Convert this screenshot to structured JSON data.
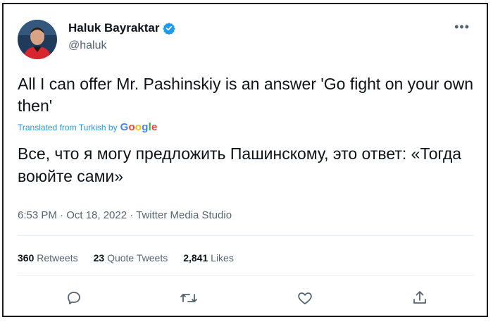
{
  "author": {
    "display_name": "Haluk Bayraktar",
    "handle": "@haluk",
    "verified": true,
    "avatar_icon": "profile-photo"
  },
  "more_label": "•••",
  "tweet": {
    "text": "All I can offer Mr. Pashinskiy is an answer 'Go fight on your own then'",
    "translated_from": "Translated from Turkish by",
    "translation_service": "Google",
    "translation": "Все, что я могу предложить Пашинскому, это ответ: «Тогда воюйте сами»"
  },
  "meta": "6:53 PM · Oct 18, 2022 · Twitter Media Studio",
  "stats": {
    "retweets_count": "360",
    "retweets_label": "Retweets",
    "quotes_count": "23",
    "quotes_label": "Quote Tweets",
    "likes_count": "2,841",
    "likes_label": "Likes"
  },
  "actions": [
    "reply-icon",
    "retweet-icon",
    "like-icon",
    "share-icon"
  ],
  "colors": {
    "text": "#0f1419",
    "secondary": "#536471",
    "accent": "#1d9bf0",
    "divider": "#e6ecf0"
  }
}
